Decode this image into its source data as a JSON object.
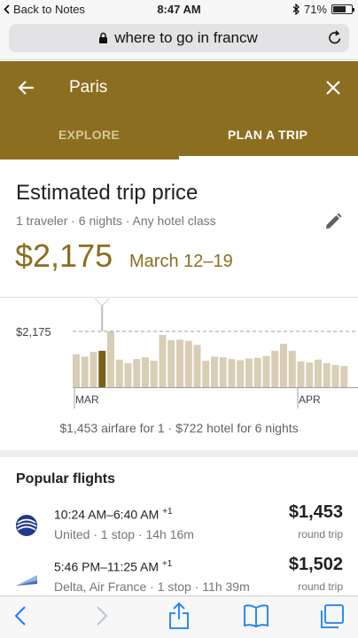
{
  "status": {
    "back_label": "Back to Notes",
    "time": "8:47 AM",
    "battery": "71%",
    "battery_level": 0.71
  },
  "address_bar": {
    "url_text": "where to go in francw",
    "lock_icon": "lock-icon",
    "reload_icon": "reload-icon"
  },
  "search": {
    "query": "Paris",
    "back_icon": "arrow-left-icon",
    "close_icon": "close-icon",
    "tabs": [
      {
        "label": "EXPLORE",
        "active": false
      },
      {
        "label": "PLAN A TRIP",
        "active": true
      }
    ]
  },
  "trip": {
    "title": "Estimated trip price",
    "details": "1 traveler · 6 nights · Any hotel class",
    "price": "$2,175",
    "dates": "March 12–19",
    "edit_icon": "pencil-icon"
  },
  "chart_data": {
    "type": "bar",
    "reference_label": "$2,175",
    "reference_value": 2175,
    "tick_labels": [
      "MAR",
      "APR"
    ],
    "selected_index": 3,
    "values": [
      1980,
      1960,
      2000,
      2010,
      2175,
      1935,
      1905,
      1940,
      1955,
      1925,
      2145,
      2100,
      2105,
      2095,
      2060,
      1925,
      1960,
      1955,
      1940,
      1930,
      1945,
      1950,
      1965,
      2010,
      2070,
      2010,
      1920,
      1910,
      1935,
      1905,
      1890,
      1880
    ]
  },
  "chart_summary": "$1,453 airfare for 1 · $722 hotel for 6 nights",
  "flights": {
    "title": "Popular flights",
    "items": [
      {
        "depart_arrive": "10:24 AM–6:40 AM",
        "day_offset": "+1",
        "meta": "United · 1 stop · 14h 16m",
        "price": "$1,453",
        "price_type": "round trip",
        "logo_icon": "united-airlines-logo"
      },
      {
        "depart_arrive": "5:46 PM–11:25 AM",
        "day_offset": "+1",
        "meta": "Delta, Air France · 1 stop · 11h 39m",
        "price": "$1,502",
        "price_type": "round trip",
        "logo_icon": "delta-airfrance-logo"
      }
    ]
  },
  "toolbar": {
    "icons": [
      "back-icon",
      "forward-icon",
      "share-icon",
      "bookmarks-icon",
      "tabs-icon"
    ]
  },
  "colors": {
    "brand_gold": "#8b6e1f",
    "bar_normal": "#d8cdb5",
    "bar_selected": "#7a5f1a",
    "ios_blue": "#157efb"
  }
}
